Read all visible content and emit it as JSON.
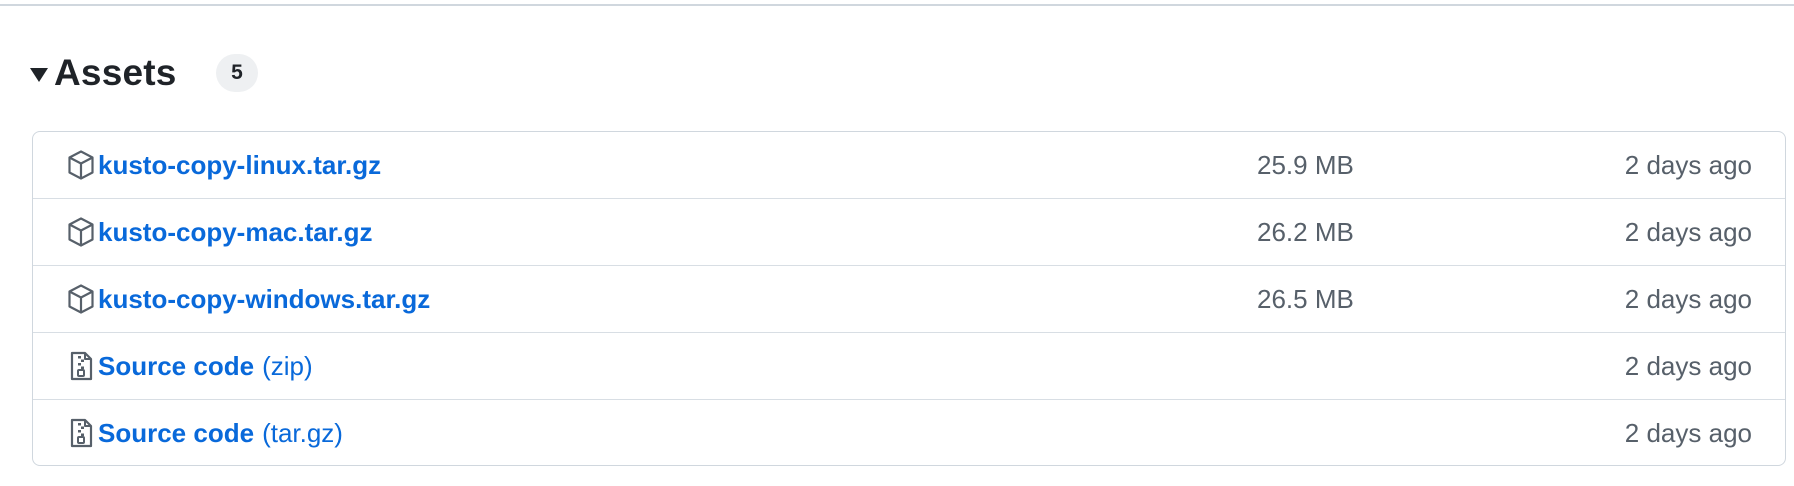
{
  "assets": {
    "title": "Assets",
    "count": "5",
    "rows": [
      {
        "icon": "package-icon",
        "name": "kusto-copy-linux.tar.gz",
        "suffix": "",
        "size": "25.9 MB",
        "time": "2 days ago"
      },
      {
        "icon": "package-icon",
        "name": "kusto-copy-mac.tar.gz",
        "suffix": "",
        "size": "26.2 MB",
        "time": "2 days ago"
      },
      {
        "icon": "package-icon",
        "name": "kusto-copy-windows.tar.gz",
        "suffix": "",
        "size": "26.5 MB",
        "time": "2 days ago"
      },
      {
        "icon": "file-zip-icon",
        "name": "Source code",
        "suffix": "(zip)",
        "size": "",
        "time": "2 days ago"
      },
      {
        "icon": "file-zip-icon",
        "name": "Source code",
        "suffix": "(tar.gz)",
        "size": "",
        "time": "2 days ago"
      }
    ]
  },
  "colors": {
    "link": "#0969da",
    "muted": "#57606a",
    "text": "#1f2328",
    "border": "#d0d7de",
    "counter_bg": "#eef0f2"
  }
}
